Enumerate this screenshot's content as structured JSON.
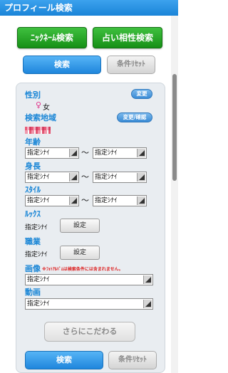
{
  "header": {
    "title": "プロフィール検索"
  },
  "top_buttons": {
    "nickname_search": "ﾆｯｸﾈｰﾑ検索",
    "fortune_search": "占い相性検索"
  },
  "actions_top": {
    "search": "検索",
    "reset": "条件ﾘｾｯﾄ"
  },
  "form": {
    "gender": {
      "label": "性別",
      "change": "変更",
      "symbol": "♀",
      "value": "女"
    },
    "area": {
      "label": "検索地域",
      "change": "変更/確認"
    },
    "age": {
      "label": "年齢",
      "min": "指定ｼﾅｲ",
      "max": "指定ｼﾅｲ",
      "sep": "〜"
    },
    "height": {
      "label": "身長",
      "min": "指定ｼﾅｲ",
      "max": "指定ｼﾅｲ",
      "sep": "〜"
    },
    "style": {
      "label": "ｽﾀｲﾙ",
      "min": "指定ｼﾅｲ",
      "max": "指定ｼﾅｲ",
      "sep": "〜"
    },
    "looks": {
      "label": "ﾙｯｸｽ",
      "value": "指定ｼﾅｲ",
      "button": "設定"
    },
    "job": {
      "label": "職業",
      "value": "指定ｼﾅｲ",
      "button": "設定"
    },
    "image": {
      "label": "画像",
      "note": "※ﾌｫﾄｱﾙﾊﾞﾑは検索条件には含まれません。",
      "value": "指定ｼﾅｲ"
    },
    "video": {
      "label": "動画",
      "value": "指定ｼﾅｲ"
    },
    "more": "さらにこだわる"
  },
  "actions_bottom": {
    "search": "検索",
    "reset": "条件ﾘｾｯﾄ"
  },
  "colors": {
    "accent": "#1a86d6",
    "green": "#179017",
    "female": "#e0348a"
  }
}
